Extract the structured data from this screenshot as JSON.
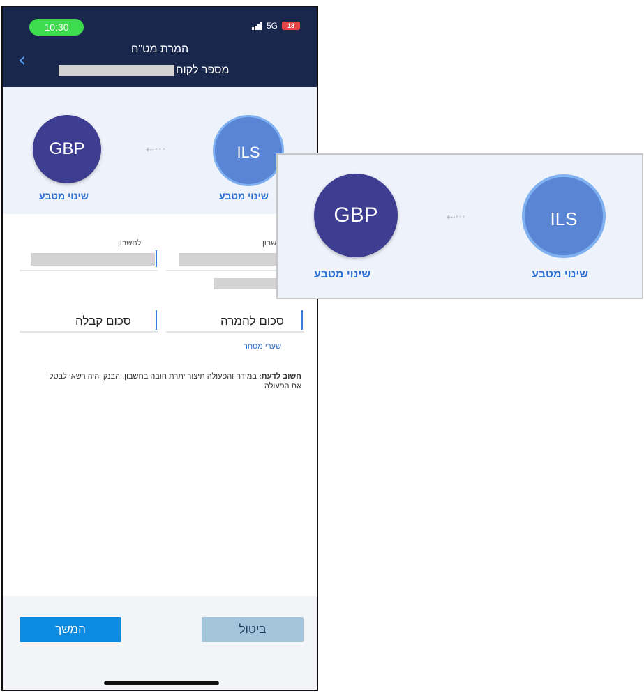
{
  "status_bar": {
    "time": "10:30",
    "network": "5G",
    "battery": "18"
  },
  "header": {
    "title": "המרת מט\"ח",
    "customer_label": "מספר לקוח"
  },
  "currency": {
    "from_code": "ILS",
    "to_code": "GBP",
    "arrow": "⇠···",
    "change_label_left": "שינוי מטבע",
    "change_label_right": "שינוי מטבע"
  },
  "form": {
    "to_account_label": "לחשבון",
    "from_account_label": "חשבון",
    "amount_convert_label": "סכום להמרה",
    "amount_receive_label": "סכום קבלה",
    "rates_link": "שערי מסחר"
  },
  "notice": {
    "bold": "חשוב לדעת:",
    "text": "במידה והפעולה תיצור יתרת חובה בחשבון, הבנק יהיה רשאי לבטל את הפעולה"
  },
  "footer": {
    "continue_label": "המשך",
    "cancel_label": "ביטול"
  },
  "colors": {
    "header_bg": "#19274d",
    "primary_button": "#0b8be2",
    "secondary_button": "#a3c4db",
    "gbp_coin": "#3d3d92",
    "ils_coin": "#5a84d4",
    "link": "#2b6fd4"
  },
  "zoom_callout": {
    "from_code": "ILS",
    "to_code": "GBP",
    "arrow": "⇠···",
    "change_label_left": "שינוי מטבע",
    "change_label_right": "שינוי מטבע"
  }
}
